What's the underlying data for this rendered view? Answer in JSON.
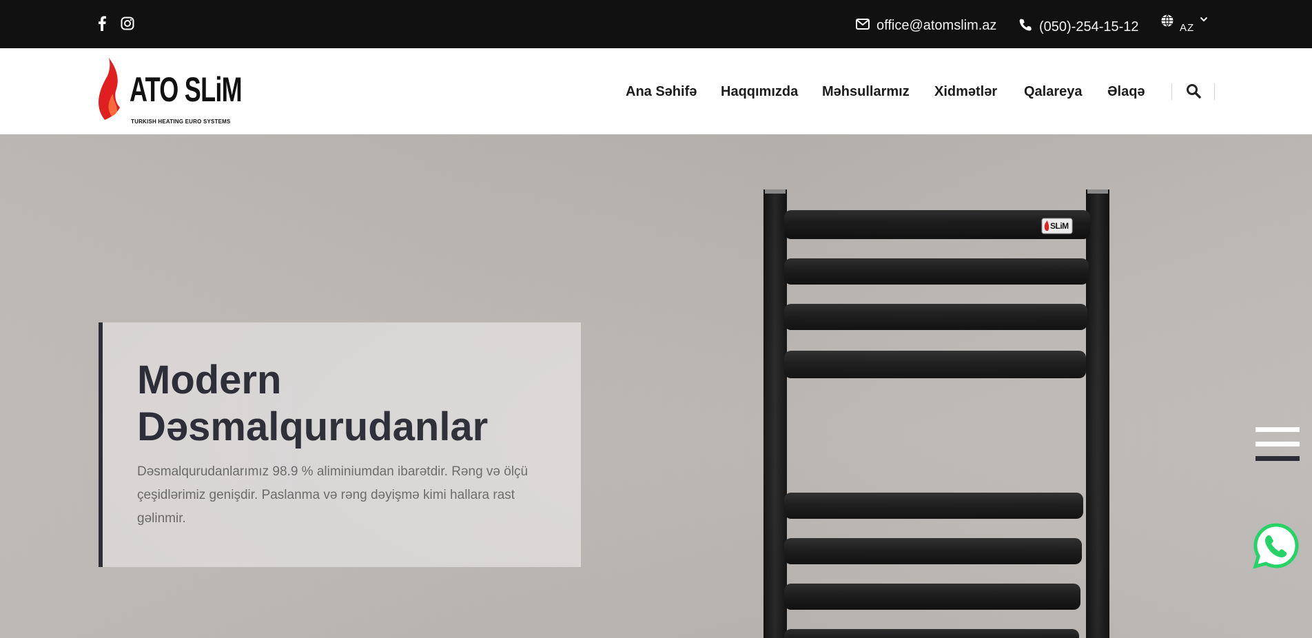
{
  "topbar": {
    "social": [
      {
        "name": "facebook",
        "icon": "facebook-icon"
      },
      {
        "name": "instagram",
        "icon": "instagram-icon"
      }
    ],
    "email": "office@atomslim.az",
    "phone": "(050)-254-15-12",
    "language": "AZ"
  },
  "nav": {
    "logo": {
      "brand": "ATO SLiM",
      "tagline": "TURKISH HEATING EURO SYSTEMS"
    },
    "menu": [
      "Ana Səhifə",
      "Haqqımızda",
      "Məhsullarmız",
      "Xidmətlər",
      "Qalareya",
      "Əlaqə"
    ]
  },
  "hero": {
    "title_line1": "Modern",
    "title_line2": "Dəsmalqurudanlar",
    "description": "Dəsmalqurudanlarımız 98.9 % aliminiumdan ibarətdir. Rəng və ölçü çeşidlərimiz genişdir. Paslanma və rəng dəyişmə kimi hallara rast gəlinmir.",
    "product_badge": "SLiM"
  },
  "colors": {
    "topbar_bg": "#111111",
    "accent_dark": "#2c2c36",
    "logo_red": "#e02020",
    "whatsapp": "#25d366"
  }
}
